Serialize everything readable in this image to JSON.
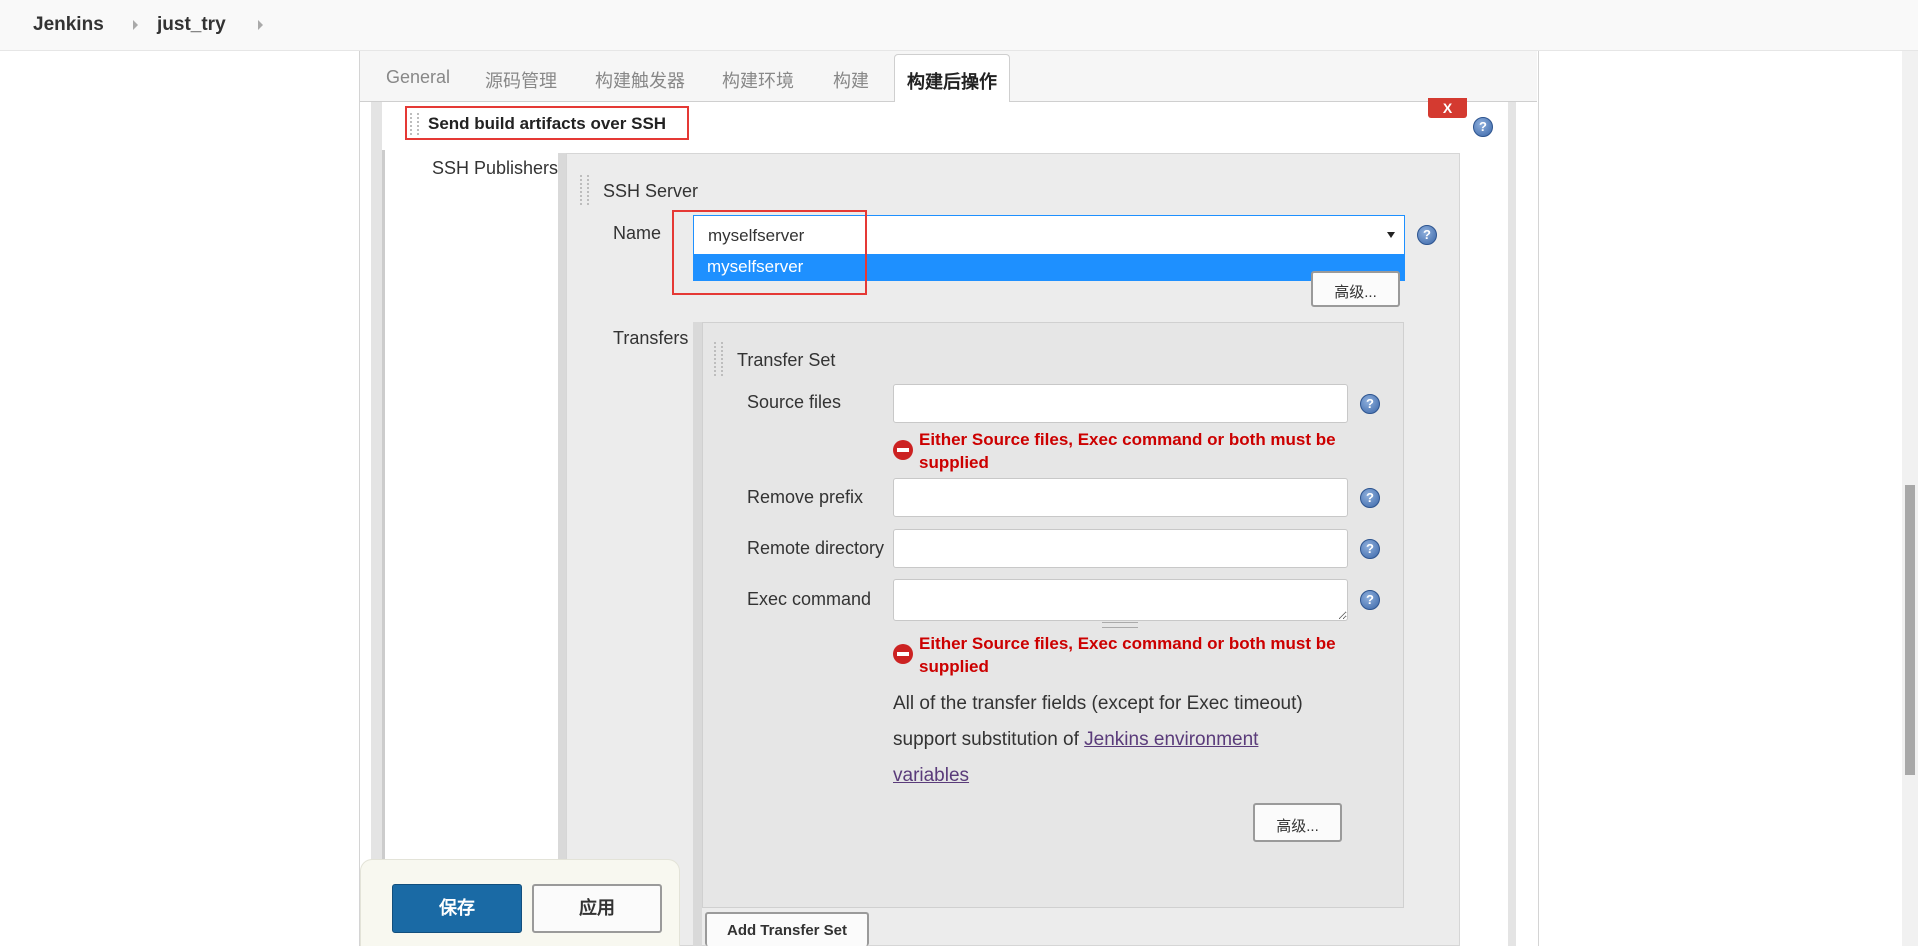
{
  "breadcrumb": {
    "home": "Jenkins",
    "job": "just_try"
  },
  "tabs": [
    {
      "label": "General"
    },
    {
      "label": "源码管理"
    },
    {
      "label": "构建触发器"
    },
    {
      "label": "构建环境"
    },
    {
      "label": "构建"
    },
    {
      "label": "构建后操作",
      "active": true
    }
  ],
  "publisher": {
    "title": "Send build artifacts over SSH",
    "delete_label": "X",
    "section_label": "SSH Publishers"
  },
  "ssh_server": {
    "title": "SSH Server",
    "name_label": "Name",
    "selected": "myselfserver",
    "dropdown_options": [
      "myselfserver"
    ],
    "advanced_label": "高级..."
  },
  "transfers": {
    "label": "Transfers",
    "set_title": "Transfer Set",
    "source_files_label": "Source files",
    "source_files_value": "",
    "remove_prefix_label": "Remove prefix",
    "remove_prefix_value": "",
    "remote_directory_label": "Remote directory",
    "remote_directory_value": "",
    "exec_command_label": "Exec command",
    "exec_command_value": "",
    "error_line1": "Either Source files, Exec command or both must be",
    "error_line2": "supplied",
    "note_line1": "All of the transfer fields (except for Exec timeout)",
    "note_line2_prefix": "support substitution of ",
    "note_link_part1": "Jenkins environment",
    "note_link_part2": "variables",
    "advanced_label": "高级...",
    "add_label": "Add Transfer Set"
  },
  "footer": {
    "save_label": "保存",
    "apply_label": "应用"
  },
  "help_glyph": "?",
  "colors": {
    "primary": "#1a6aa5",
    "selection": "#1e90ff",
    "error": "#cc0000",
    "highlight_outline": "#e53935"
  }
}
